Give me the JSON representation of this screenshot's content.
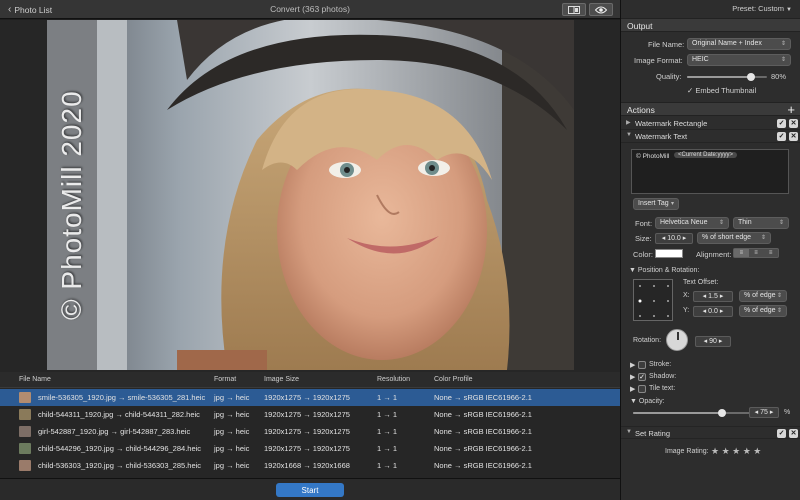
{
  "toolbar": {
    "back_label": "Photo List",
    "title": "Convert (363 photos)",
    "compare_icon": "compare-icon",
    "eye_icon": "eye-icon"
  },
  "preview": {
    "watermark_text": "© PhotoMill 2020"
  },
  "file_list": {
    "columns": [
      "File Name",
      "Format",
      "Image Size",
      "Resolution",
      "Color Profile"
    ],
    "rows": [
      {
        "name": "smile-536305_1920.jpg → smile-536305_281.heic",
        "format": "jpg → heic",
        "size": "1920x1275 → 1920x1275",
        "resolution": "1 → 1",
        "profile": "None → sRGB IEC61966-2.1",
        "selected": true
      },
      {
        "name": "child-544311_1920.jpg → child-544311_282.heic",
        "format": "jpg → heic",
        "size": "1920x1275 → 1920x1275",
        "resolution": "1 → 1",
        "profile": "None → sRGB IEC61966-2.1",
        "selected": false
      },
      {
        "name": "girl-542887_1920.jpg → girl-542887_283.heic",
        "format": "jpg → heic",
        "size": "1920x1275 → 1920x1275",
        "resolution": "1 → 1",
        "profile": "None → sRGB IEC61966-2.1",
        "selected": false
      },
      {
        "name": "child-544296_1920.jpg → child-544296_284.heic",
        "format": "jpg → heic",
        "size": "1920x1275 → 1920x1275",
        "resolution": "1 → 1",
        "profile": "None → sRGB IEC61966-2.1",
        "selected": false
      },
      {
        "name": "child-536303_1920.jpg → child-536303_285.heic",
        "format": "jpg → heic",
        "size": "1920x1668 → 1920x1668",
        "resolution": "1 → 1",
        "profile": "None → sRGB IEC61966-2.1",
        "selected": false
      }
    ],
    "start_label": "Start"
  },
  "panel": {
    "preset": "Preset: Custom",
    "output": {
      "header": "Output",
      "file_name_label": "File Name:",
      "file_name_value": "Original Name + Index",
      "format_label": "Image Format:",
      "format_value": "HEIC",
      "quality_label": "Quality:",
      "quality_value": "80%",
      "quality_fraction": 0.8,
      "embed_label": "Embed Thumbnail"
    },
    "actions": {
      "header": "Actions",
      "add_icon": "plus-icon",
      "items": [
        "Watermark Rectangle",
        "Watermark Text",
        "Set Rating"
      ]
    },
    "watermark_text": {
      "text_prefix": "© PhotoMill",
      "token": "<Current Date:yyyy>",
      "insert_tag": "Insert Tag",
      "font_label": "Font:",
      "font_value": "Helvetica Neue",
      "weight_value": "Thin",
      "size_label": "Size:",
      "size_value": "10.0",
      "size_unit": "% of short edge",
      "color_label": "Color:",
      "alignment_label": "Alignment:",
      "position_header": "Position & Rotation:",
      "offset_label": "Text Offset:",
      "x_label": "X:",
      "x_value": "1.5",
      "x_unit": "% of edge",
      "y_label": "Y:",
      "y_value": "0.0",
      "y_unit": "% of edge",
      "rotation_label": "Rotation:",
      "rotation_value": "90",
      "stroke_label": "Stroke:",
      "shadow_label": "Shadow:",
      "tile_label": "Tile text:",
      "opacity_label": "Opacity:",
      "opacity_value": "75",
      "opacity_fraction": 0.75,
      "percent": "%"
    },
    "rating": {
      "label": "Image Rating:",
      "stars": "★ ★ ★ ★ ★"
    }
  }
}
